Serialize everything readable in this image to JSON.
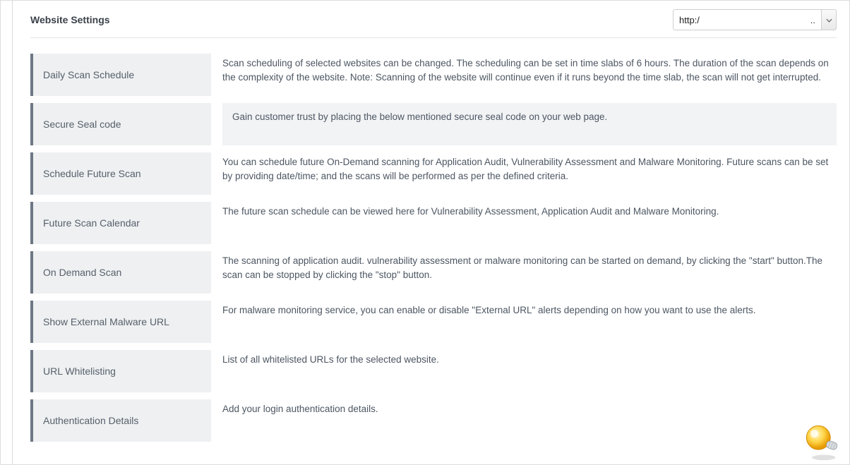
{
  "header": {
    "title": "Website Settings",
    "site_select": {
      "prefix": "http:/",
      "masked": " ",
      "dots": ".."
    }
  },
  "settings": [
    {
      "id": "daily-scan-schedule",
      "label": "Daily Scan Schedule",
      "desc": "Scan scheduling of selected websites can be changed. The scheduling can be set in time slabs of 6 hours. The duration of the scan depends on the complexity of the website. Note: Scanning of the website will continue even if it runs beyond the time slab, the scan will not get interrupted.",
      "alt": false
    },
    {
      "id": "secure-seal-code",
      "label": "Secure Seal code",
      "desc": "Gain customer trust by placing the below mentioned secure seal code on your web page.",
      "alt": true
    },
    {
      "id": "schedule-future-scan",
      "label": "Schedule Future Scan",
      "desc": "You can schedule future On-Demand scanning for Application Audit, Vulnerability Assessment and Malware Monitoring. Future scans can be set by providing date/time; and the scans will be performed as per the defined criteria.",
      "alt": false
    },
    {
      "id": "future-scan-calendar",
      "label": "Future Scan Calendar",
      "desc": "The future scan schedule can be viewed here for Vulnerability Assessment, Application Audit and Malware Monitoring.",
      "alt": false
    },
    {
      "id": "on-demand-scan",
      "label": "On Demand Scan",
      "desc": "The scanning of application audit. vulnerability assessment or malware monitoring can be started on demand, by clicking the \"start\" button.The scan can be stopped by clicking the \"stop\" button.",
      "alt": false
    },
    {
      "id": "show-external-malware-url",
      "label": "Show External Malware URL",
      "desc": "For malware monitoring service, you can enable or disable \"External URL\" alerts depending on how you want to use the alerts.",
      "alt": false
    },
    {
      "id": "url-whitelisting",
      "label": "URL Whitelisting",
      "desc": "List of all whitelisted URLs for the selected website.",
      "alt": false
    },
    {
      "id": "authentication-details",
      "label": "Authentication Details",
      "desc": "Add your login authentication details.",
      "alt": false
    }
  ]
}
